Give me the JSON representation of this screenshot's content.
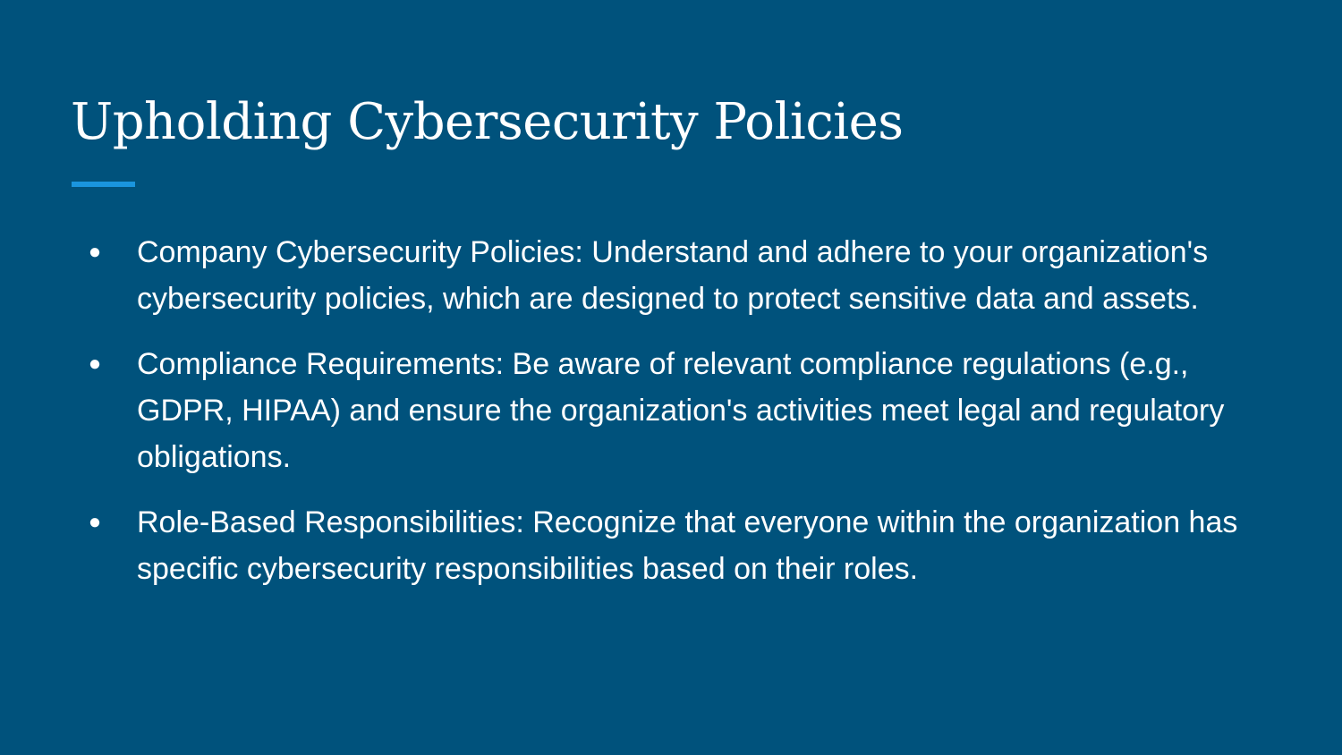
{
  "slide": {
    "title": "Upholding Cybersecurity Policies",
    "accent_color": "#1a95de",
    "background_color": "#00527c",
    "bullet_symbol": "●",
    "bullets": [
      "Company Cybersecurity Policies: Understand and adhere to your organization's cybersecurity policies, which are designed to protect sensitive data and assets.",
      "Compliance Requirements: Be aware of relevant compliance regulations (e.g., GDPR, HIPAA) and ensure the organization's activities meet legal and regulatory obligations.",
      "Role-Based Responsibilities: Recognize that everyone within the organization has specific cybersecurity responsibilities based on their roles."
    ]
  }
}
